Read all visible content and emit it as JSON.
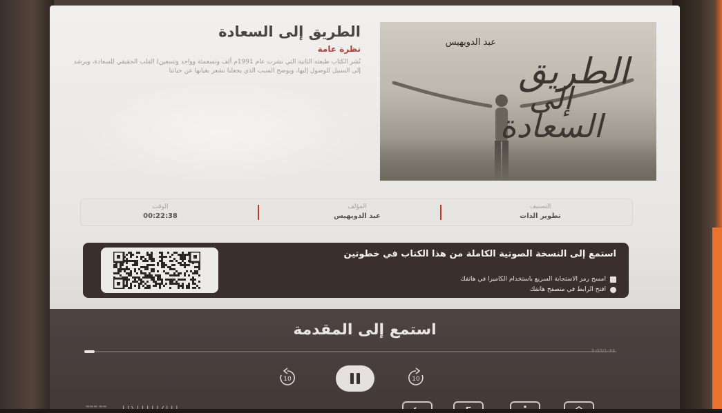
{
  "book": {
    "title": "الطريق إلى السعادة",
    "overview_label": "نظرة عامة",
    "overview_text": "نُشر الكتاب طبعته الثانية التي نشرت عام 1991م ألف وتسعمئة وواحد وتسعين) القلب الحقيقي للسعادة، ويرشد إلى السبيل للوصول إليها، ويوضح السبب الذي يجعلنا نشعر بغيابها عن حياتنا",
    "cover": {
      "author": "عبد الدويهيس",
      "title_line1": "الطريق",
      "title_line2": "إلى",
      "title_line3": "السعادة"
    }
  },
  "info": {
    "category_label": "التصنيف",
    "category_value": "تطوير الذات",
    "author_label": "المؤلف",
    "author_value": "عبد الدويهيس",
    "time_label": "الوقت",
    "time_value": "00:22:38"
  },
  "audio_card": {
    "title": "استمع إلى النسخة الصوتية الكاملة من هذا الكتاب في خطوتين",
    "step1": "امسح رمز الاستجابة السريع باستخدام الكاميرا في هاتفك",
    "step2": "افتح الرابط في متصفح هاتفك"
  },
  "player": {
    "title": "استمع إلى المقدمة",
    "elapsed": "0:00/1:33",
    "progress_fraction": 0.02,
    "rewind_label": "10",
    "forward_label": "10",
    "state": "playing"
  },
  "bottom_bar": {
    "back_icon": "arrow-left-icon",
    "language_label": "E",
    "accessibility_icon": "wheelchair-icon",
    "home_icon": "home-icon"
  },
  "colors": {
    "accent": "#a8453a",
    "separator": "#c0392b",
    "card_dark": "#3a2f2c",
    "player_bg": "#4d4442"
  }
}
